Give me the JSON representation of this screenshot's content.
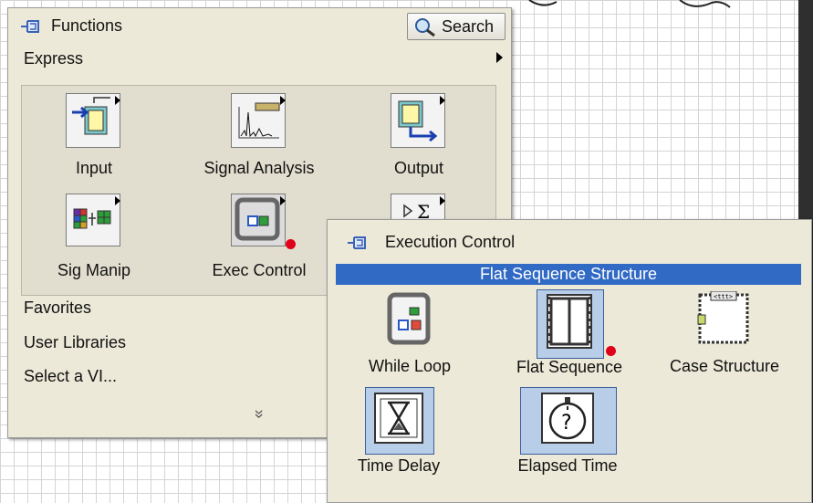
{
  "functions_palette": {
    "title": "Functions",
    "search_label": "Search",
    "express_label": "Express",
    "tiles": [
      {
        "label": "Input",
        "icon": "express-input-icon"
      },
      {
        "label": "Signal Analysis",
        "icon": "signal-analysis-icon"
      },
      {
        "label": "Output",
        "icon": "express-output-icon"
      },
      {
        "label": "Sig Manip",
        "icon": "sig-manip-icon"
      },
      {
        "label": "Exec Control",
        "icon": "exec-control-icon"
      },
      {
        "label": "",
        "icon": "arith-compare-icon"
      }
    ],
    "categories": [
      "Favorites",
      "User Libraries",
      "Select a VI..."
    ],
    "expand_glyph": "»"
  },
  "exec_palette": {
    "title": "Execution Control",
    "tooltip": "Flat Sequence Structure",
    "items": [
      {
        "label": "While Loop",
        "icon": "while-loop-icon"
      },
      {
        "label": "Flat Sequence",
        "icon": "flat-sequence-icon"
      },
      {
        "label": "Case Structure",
        "icon": "case-structure-icon"
      },
      {
        "label": "Time Delay",
        "icon": "time-delay-icon"
      },
      {
        "label": "Elapsed Time",
        "icon": "elapsed-time-icon"
      }
    ]
  },
  "colors": {
    "palette_bg": "#ece9d8",
    "selection_blue": "#316ac5",
    "red_marker": "#e0001a"
  }
}
